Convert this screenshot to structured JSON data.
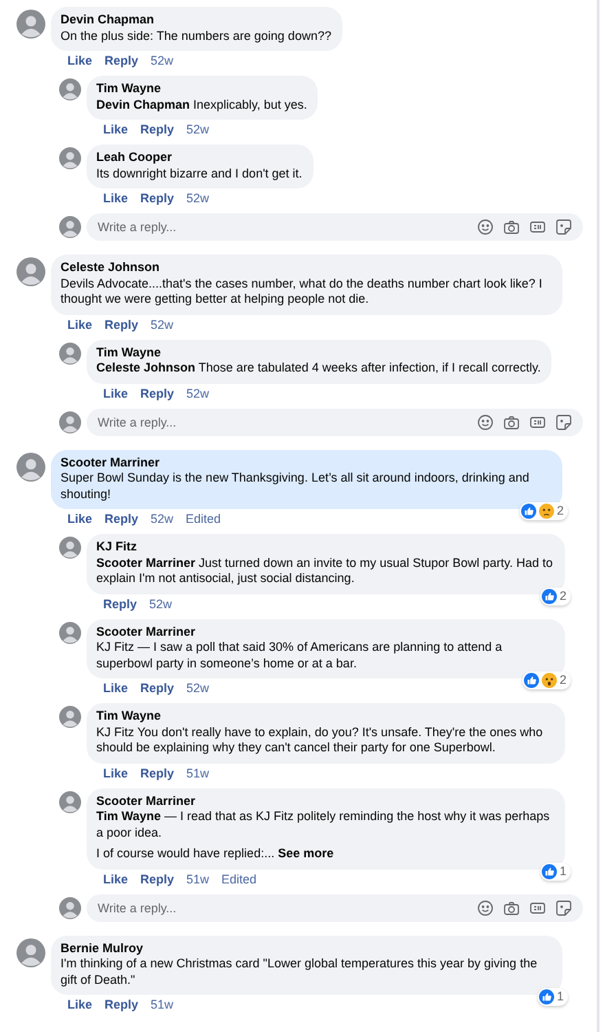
{
  "threads": [
    {
      "comment": {
        "author": "Devin Chapman",
        "text": "On the plus side: The numbers are going down??",
        "highlighted": false,
        "actions": [
          "Like",
          "Reply"
        ],
        "time": "52w"
      },
      "replies": [
        {
          "author": "Tim Wayne",
          "text": "**Devin Chapman** Inexplicably, but yes.",
          "actions": [
            "Like",
            "Reply"
          ],
          "time": "52w"
        },
        {
          "author": "Leah Cooper",
          "text": "Its downright bizarre and I don't get it.",
          "actions": [
            "Like",
            "Reply"
          ],
          "time": "52w"
        }
      ],
      "reply_box": {
        "placeholder": "Write a reply..."
      }
    },
    {
      "comment": {
        "author": "Celeste Johnson",
        "text": "Devils Advocate....that's the cases number, what do the deaths number chart look like? I thought we were getting better at helping people not die.",
        "highlighted": false,
        "actions": [
          "Like",
          "Reply"
        ],
        "time": "52w"
      },
      "replies": [
        {
          "author": "Tim Wayne",
          "text": "**Celeste Johnson** Those are tabulated 4 weeks after infection, if I recall correctly.",
          "actions": [
            "Like",
            "Reply"
          ],
          "time": "52w"
        }
      ],
      "reply_box": {
        "placeholder": "Write a reply..."
      }
    },
    {
      "comment": {
        "author": "Scooter Marriner",
        "text": "Super Bowl Sunday is the new Thanksgiving. Let’s all sit around indoors, drinking and shouting!",
        "highlighted": true,
        "actions": [
          "Like",
          "Reply"
        ],
        "time": "52w",
        "edited": "Edited",
        "reactions": {
          "icons": [
            {
              "kind": "like"
            },
            {
              "kind": "sad"
            }
          ],
          "count": "2"
        }
      },
      "replies": [
        {
          "author": "KJ Fitz",
          "text": "**Scooter Marriner** Just turned down an invite to my usual Stupor Bowl party. Had to explain I'm not antisocial, just social distancing.",
          "actions": [
            "Reply"
          ],
          "time": "52w",
          "reactions": {
            "icons": [
              {
                "kind": "like"
              }
            ],
            "count": "2"
          }
        },
        {
          "author": "Scooter Marriner",
          "text": "KJ Fitz — I saw a poll that said 30% of Americans are planning to attend a superbowl party in someone’s home or at a bar.",
          "actions": [
            "Like",
            "Reply"
          ],
          "time": "52w",
          "reactions": {
            "icons": [
              {
                "kind": "like"
              },
              {
                "kind": "wow"
              }
            ],
            "count": "2"
          }
        },
        {
          "author": "Tim Wayne",
          "text": "KJ Fitz You don't really have to explain, do you? It's unsafe. They're the ones who should be explaining why they can't cancel their party for one Superbowl.",
          "actions": [
            "Like",
            "Reply"
          ],
          "time": "51w"
        },
        {
          "author": "Scooter Marriner",
          "text": "**Tim Wayne** — I read that as KJ Fitz politely reminding the host why it was perhaps a poor idea.",
          "more_text": "I of course would have replied:...",
          "see_more": "See more",
          "actions": [
            "Like",
            "Reply"
          ],
          "time": "51w",
          "edited": "Edited",
          "reactions": {
            "icons": [
              {
                "kind": "like"
              }
            ],
            "count": "1"
          }
        }
      ],
      "reply_box": {
        "placeholder": "Write a reply..."
      }
    },
    {
      "comment": {
        "author": "Bernie Mulroy",
        "text": "I'm thinking of a new Christmas card \"Lower global temperatures this year by giving the gift of Death.\"",
        "highlighted": false,
        "actions": [
          "Like",
          "Reply"
        ],
        "time": "51w",
        "reactions": {
          "icons": [
            {
              "kind": "like"
            }
          ],
          "count": "1"
        }
      }
    }
  ]
}
